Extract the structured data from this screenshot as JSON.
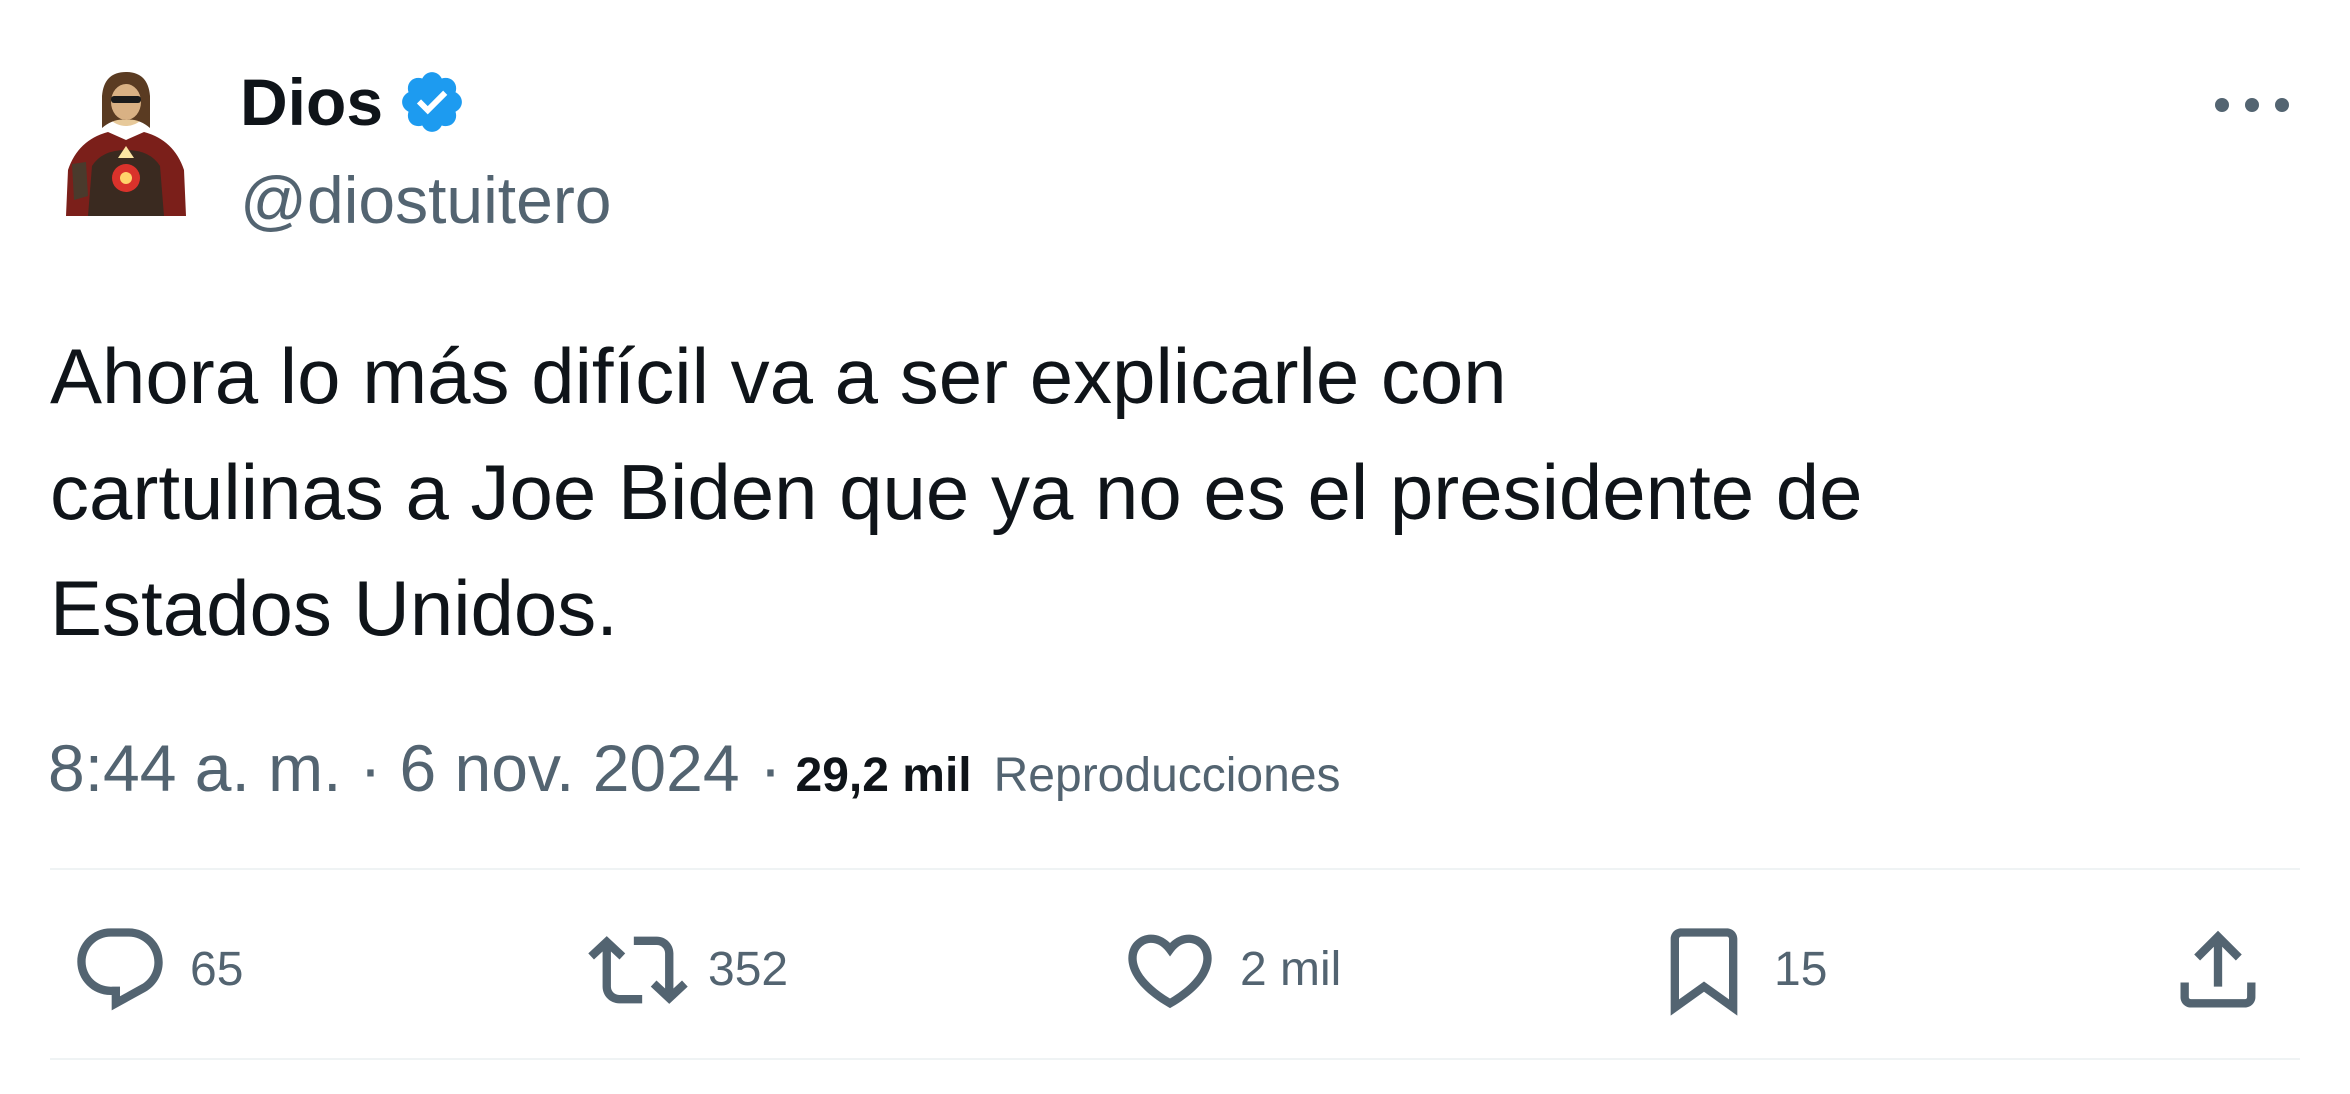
{
  "author": {
    "display_name": "Dios",
    "handle": "@diostuitero",
    "verified": true,
    "avatar_icon": "religious-figure-avatar"
  },
  "tweet": {
    "text": "Ahora lo más difícil va a ser explicarle con\ncartulinas a Joe Biden que ya no es el presidente de\nEstados Unidos.",
    "time": "8:44 a. m.",
    "separator": "·",
    "date": "6 nov. 2024",
    "views_count": "29,2 mil",
    "views_label": "Reproducciones"
  },
  "actions": {
    "reply": {
      "icon": "reply-bubble-icon",
      "count": "65"
    },
    "retweet": {
      "icon": "retweet-icon",
      "count": "352"
    },
    "like": {
      "icon": "heart-icon",
      "count": "2 mil"
    },
    "bookmark": {
      "icon": "bookmark-icon",
      "count": "15"
    },
    "share": {
      "icon": "share-upload-icon"
    }
  },
  "menu": {
    "icon": "more-options-icon"
  },
  "colors": {
    "text_primary": "#0f1419",
    "text_secondary": "#536471",
    "verified_blue": "#1d9bf0",
    "divider": "#eff3f4"
  }
}
